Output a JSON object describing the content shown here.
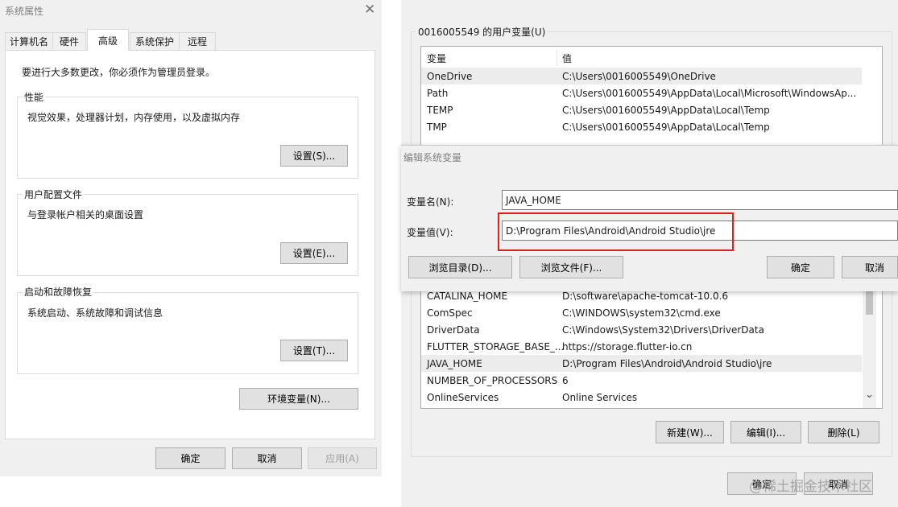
{
  "left": {
    "title": "系统属性",
    "close_glyph": "✕",
    "tabs": [
      {
        "label": "计算机名"
      },
      {
        "label": "硬件"
      },
      {
        "label": "高级"
      },
      {
        "label": "系统保护"
      },
      {
        "label": "远程"
      }
    ],
    "admin_note": "要进行大多数更改，你必须作为管理员登录。",
    "performance": {
      "title": "性能",
      "desc": "视觉效果，处理器计划，内存使用，以及虚拟内存",
      "button": "设置(S)..."
    },
    "profile": {
      "title": "用户配置文件",
      "desc": "与登录帐户相关的桌面设置",
      "button": "设置(E)..."
    },
    "startup": {
      "title": "启动和故障恢复",
      "desc": "系统启动、系统故障和调试信息",
      "button": "设置(T)..."
    },
    "env_button": "环境变量(N)...",
    "ok": "确定",
    "cancel": "取消",
    "apply": "应用(A)"
  },
  "right": {
    "user_vars_title": "0016005549 的用户变量(U)",
    "columns": {
      "name": "变量",
      "value": "值"
    },
    "user_vars": [
      {
        "name": "OneDrive",
        "value": "C:\\Users\\0016005549\\OneDrive"
      },
      {
        "name": "Path",
        "value": "C:\\Users\\0016005549\\AppData\\Local\\Microsoft\\WindowsAp..."
      },
      {
        "name": "TEMP",
        "value": "C:\\Users\\0016005549\\AppData\\Local\\Temp"
      },
      {
        "name": "TMP",
        "value": "C:\\Users\\0016005549\\AppData\\Local\\Temp"
      }
    ],
    "sys_vars": [
      {
        "name": "CATALINA_HOME",
        "value": "D:\\software\\apache-tomcat-10.0.6"
      },
      {
        "name": "ComSpec",
        "value": "C:\\WINDOWS\\system32\\cmd.exe"
      },
      {
        "name": "DriverData",
        "value": "C:\\Windows\\System32\\Drivers\\DriverData"
      },
      {
        "name": "FLUTTER_STORAGE_BASE_...",
        "value": "https://storage.flutter-io.cn"
      },
      {
        "name": "JAVA_HOME",
        "value": "D:\\Program Files\\Android\\Android Studio\\jre"
      },
      {
        "name": "NUMBER_OF_PROCESSORS",
        "value": "6"
      },
      {
        "name": "OnlineServices",
        "value": "Online Services"
      }
    ],
    "new": "新建(W)...",
    "edit": "编辑(I)...",
    "delete": "删除(L)",
    "ok": "确定",
    "cancel": "取消",
    "scroll_down_glyph": "⌄"
  },
  "edit_dialog": {
    "title": "编辑系统变量",
    "name_label": "变量名(N):",
    "name_value": "JAVA_HOME",
    "value_label": "变量值(V):",
    "value_value": "D:\\Program Files\\Android\\Android Studio\\jre",
    "browse_dir": "浏览目录(D)...",
    "browse_file": "浏览文件(F)...",
    "ok": "确定",
    "cancel": "取消"
  },
  "watermark": "@稀土掘金技术社区",
  "colors": {
    "highlight_border": "#e0201a"
  }
}
